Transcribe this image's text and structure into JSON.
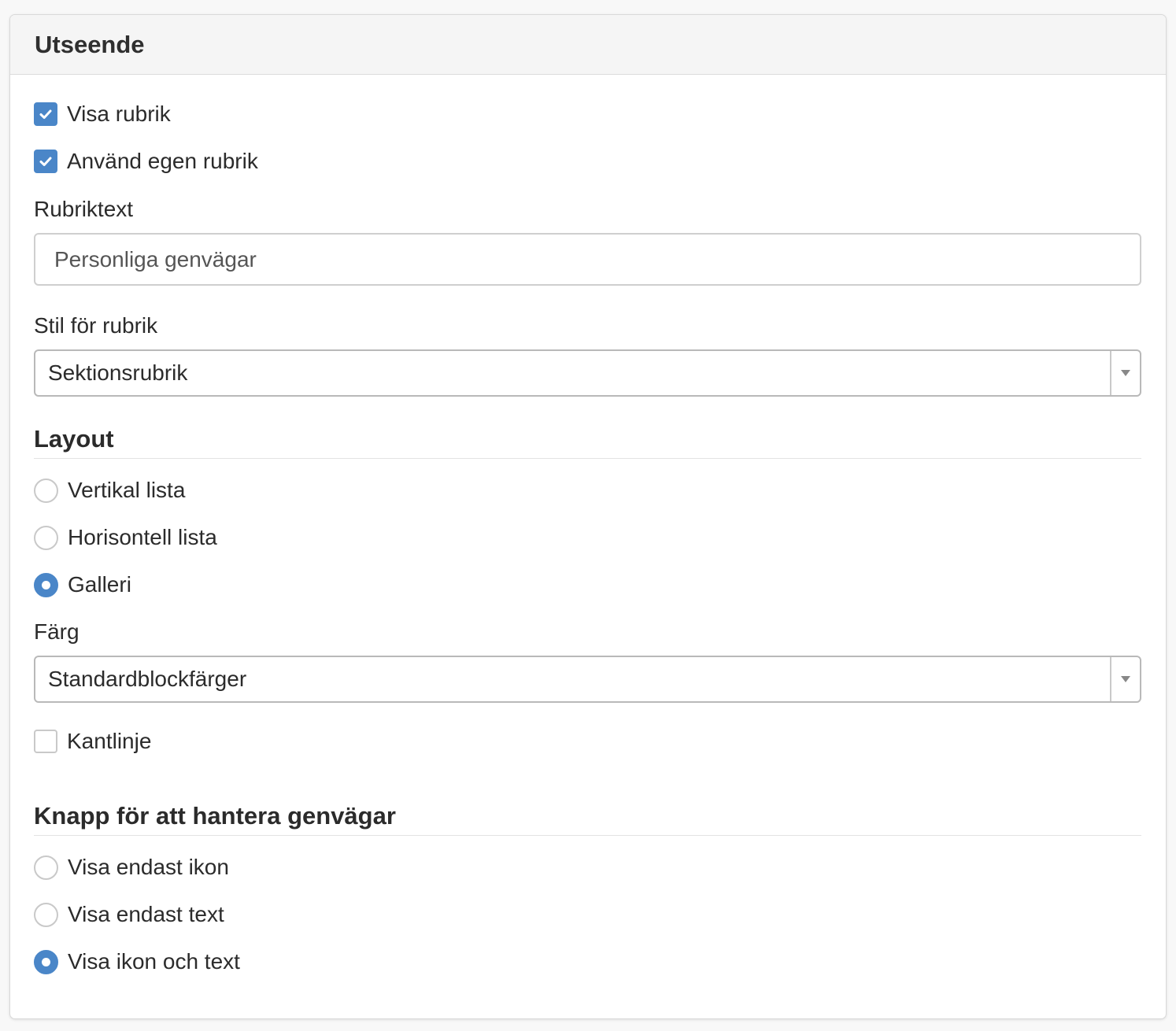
{
  "panel": {
    "title": "Utseende"
  },
  "heading": {
    "show_heading": {
      "label": "Visa rubrik",
      "checked": true
    },
    "custom_heading": {
      "label": "Använd egen rubrik",
      "checked": true
    },
    "text_label": "Rubriktext",
    "text_value": "Personliga genvägar",
    "style_label": "Stil för rubrik",
    "style_value": "Sektionsrubrik"
  },
  "layout": {
    "title": "Layout",
    "options": [
      {
        "label": "Vertikal lista",
        "checked": false
      },
      {
        "label": "Horisontell lista",
        "checked": false
      },
      {
        "label": "Galleri",
        "checked": true
      }
    ],
    "color_label": "Färg",
    "color_value": "Standardblockfärger",
    "border": {
      "label": "Kantlinje",
      "checked": false
    }
  },
  "manage_button": {
    "title": "Knapp för att hantera genvägar",
    "options": [
      {
        "label": "Visa endast ikon",
        "checked": false
      },
      {
        "label": "Visa endast text",
        "checked": false
      },
      {
        "label": "Visa ikon och text",
        "checked": true
      }
    ]
  },
  "colors": {
    "accent": "#4a86c8"
  }
}
